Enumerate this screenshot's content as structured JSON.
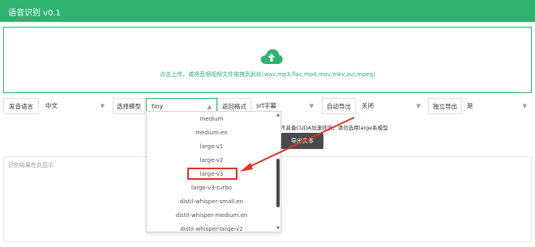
{
  "header": {
    "title": "语音识别 v0.1"
  },
  "upload": {
    "hint": "点击上传，或将音频视频文件拖拽到此处(wav,mp3,flac,mp4,mov,mkv,avi,mpeg)",
    "icon": "cloud-upload-icon"
  },
  "options": {
    "language": {
      "label": "发音语言",
      "value": "中文"
    },
    "model": {
      "label": "选择模型",
      "value": "tiny"
    },
    "format": {
      "label": "返回格式",
      "value": "srt字幕"
    },
    "auto_export": {
      "label": "自动导出",
      "value": "关闭"
    },
    "standalone_export": {
      "label": "独立导出",
      "value": "是"
    }
  },
  "tip": "不具备CUDA加速环境，请勿选用large系模型",
  "export_button": "导出文本",
  "result": {
    "placeholder": "识别结果在此显示"
  },
  "model_dropdown": {
    "options": [
      "medium",
      "medium.en",
      "large-v1",
      "large-v2",
      "large-v3",
      "large-v3-turbo",
      "distil-whisper-small.en",
      "distil-whisper-medium.en",
      "distil-whisper-large-v2"
    ],
    "highlighted": "large-v3"
  },
  "colors": {
    "accent": "#2fb170",
    "annotation": "#d9352b",
    "button": "#4b4b4b"
  }
}
